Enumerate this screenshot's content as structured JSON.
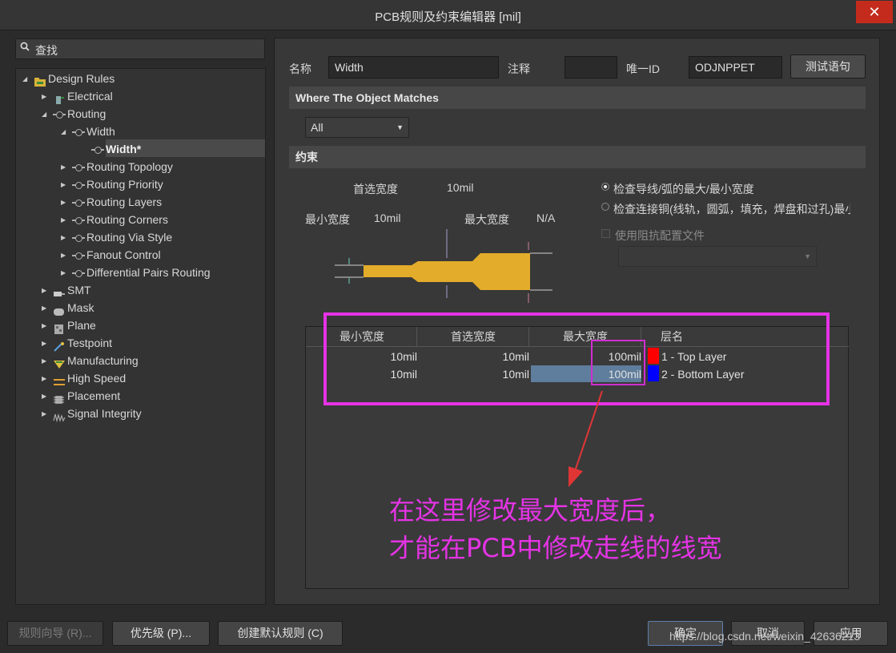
{
  "window": {
    "title": "PCB规则及约束编辑器 [mil]",
    "close_glyph": "✕"
  },
  "search": {
    "placeholder": "查找"
  },
  "tree": {
    "root": "Design Rules",
    "electrical": "Electrical",
    "routing": "Routing",
    "width": "Width",
    "width_rule": "Width*",
    "routing_topology": "Routing Topology",
    "routing_priority": "Routing Priority",
    "routing_layers": "Routing Layers",
    "routing_corners": "Routing Corners",
    "routing_via_style": "Routing Via Style",
    "fanout_control": "Fanout Control",
    "differential_pairs": "Differential Pairs Routing",
    "smt": "SMT",
    "mask": "Mask",
    "plane": "Plane",
    "testpoint": "Testpoint",
    "manufacturing": "Manufacturing",
    "high_speed": "High Speed",
    "placement": "Placement",
    "signal_integrity": "Signal Integrity"
  },
  "rule": {
    "name_label": "名称",
    "name_value": "Width",
    "comment_label": "注释",
    "comment_value": "",
    "uid_label": "唯一ID",
    "uid_value": "ODJNPPET",
    "test_button": "测试语句"
  },
  "where": {
    "header": "Where The Object Matches",
    "scope": "All"
  },
  "constraints": {
    "header": "约束",
    "preferred_label": "首选宽度",
    "preferred_value": "10mil",
    "min_label": "最小宽度",
    "min_value": "10mil",
    "max_label": "最大宽度",
    "max_value": "N/A",
    "radio1": "检查导线/弧的最大/最小宽度",
    "radio2": "检查连接铜(线轨，圆弧，填充，焊盘和过孔)最小",
    "impedance_label": "使用阻抗配置文件"
  },
  "grid": {
    "headers": [
      "最小宽度",
      "首选宽度",
      "最大宽度",
      "层名"
    ],
    "rows": [
      {
        "min": "10mil",
        "pref": "10mil",
        "max": "100mil",
        "layer": "1 - Top Layer",
        "color": "#ff0000"
      },
      {
        "min": "10mil",
        "pref": "10mil",
        "max": "100mil",
        "layer": "2 - Bottom Layer",
        "color": "#0000ff"
      }
    ]
  },
  "annotation": {
    "line1": "在这里修改最大宽度后，",
    "line2": "才能在PCB中修改走线的线宽",
    "color": "#e533e5"
  },
  "footer": {
    "wizard": "规则向导 (R)...",
    "priority": "优先级 (P)...",
    "create_default": "创建默认规则 (C)",
    "ok": "确定",
    "cancel": "取消",
    "apply": "应用",
    "watermark": "https://blog.csdn.net/weixin_42636213"
  }
}
